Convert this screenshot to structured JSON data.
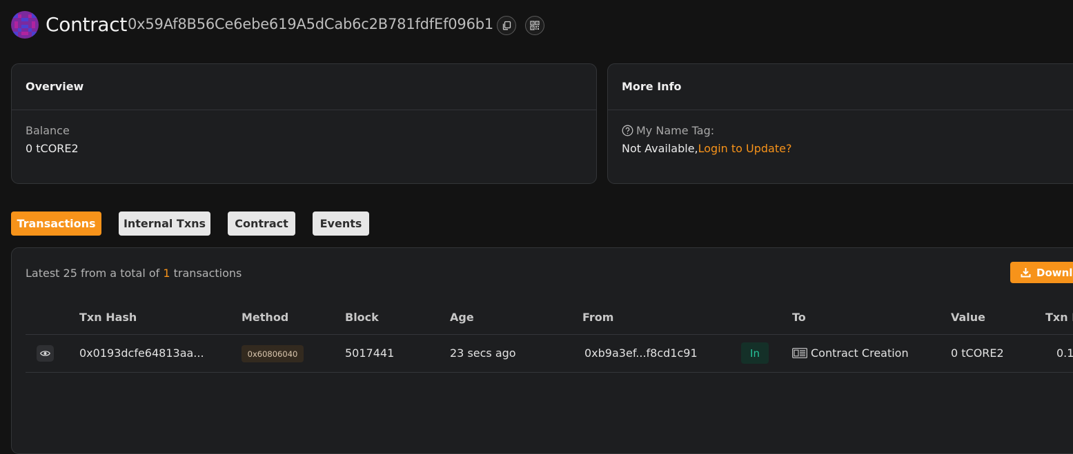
{
  "header": {
    "title": "Contract",
    "address": "0x59Af8B56Ce6ebe619A5dCab6c2B781fdfEf096b1",
    "copy_icon": "copy-icon",
    "qr_icon": "qr-code-icon"
  },
  "overview": {
    "title": "Overview",
    "balance_label": "Balance",
    "balance_value": "0 tCORE2"
  },
  "more_info": {
    "title": "More Info",
    "name_tag_label": "My Name Tag:",
    "name_tag_value": "Not Available,",
    "login_link": "Login to Update?"
  },
  "tabs": [
    {
      "label": "Transactions",
      "active": true
    },
    {
      "label": "Internal Txns",
      "active": false
    },
    {
      "label": "Contract",
      "active": false
    },
    {
      "label": "Events",
      "active": false
    }
  ],
  "transactions": {
    "summary_prefix": "Latest 25 from a total of ",
    "summary_count": "1",
    "summary_suffix": " transactions",
    "download_label": "Download",
    "columns": [
      "Txn Hash",
      "Method",
      "Block",
      "Age",
      "From",
      "To",
      "Value",
      "Txn Fee"
    ],
    "rows": [
      {
        "txn_hash": "0x0193dcfe64813aa...",
        "method": "0x60806040",
        "block": "5017441",
        "age": "23 secs ago",
        "from": "0xb9a3ef...f8cd1c91",
        "direction": "In",
        "to": "Contract Creation",
        "value": "0 tCORE2",
        "txn_fee": "0.1"
      }
    ]
  },
  "colors": {
    "accent": "#f7931a",
    "background": "#131313",
    "card": "#1d1e20",
    "in_badge": "#26c39a"
  }
}
